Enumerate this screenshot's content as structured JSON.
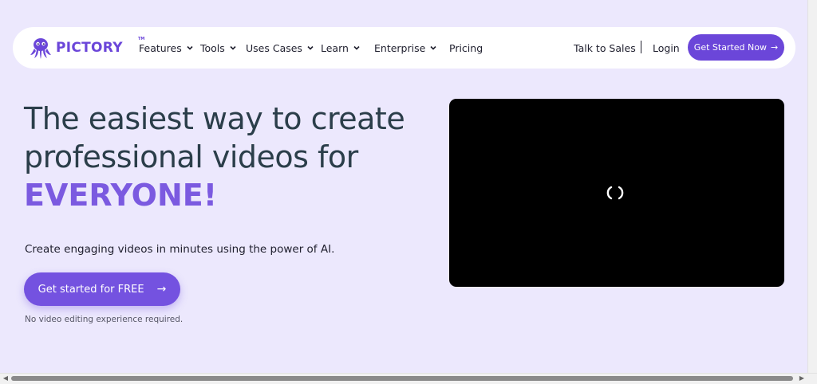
{
  "brand": {
    "name": "PICTORY",
    "tm": "TM",
    "color": "#6b46d9"
  },
  "nav": {
    "items": [
      {
        "label": "Features",
        "has_dropdown": true
      },
      {
        "label": "Tools",
        "has_dropdown": true
      },
      {
        "label": "Uses Cases",
        "has_dropdown": true
      },
      {
        "label": "Learn",
        "has_dropdown": true
      },
      {
        "label": "Enterprise",
        "has_dropdown": true
      },
      {
        "label": "Pricing",
        "has_dropdown": false
      }
    ],
    "talk_to_sales": "Talk to Sales",
    "separator": "|",
    "login": "Login",
    "cta": "Get Started Now",
    "cta_arrow": "→"
  },
  "hero": {
    "title_line1": "The easiest way to create",
    "title_line2": "professional videos for",
    "title_accent": "EVERYONE!",
    "subtitle": "Create engaging videos in minutes using the power of AI.",
    "cta": "Get started for FREE",
    "cta_arrow": "→",
    "note": "No video editing experience required."
  },
  "video": {
    "state": "loading",
    "icon": "loading-spinner-icon"
  },
  "colors": {
    "background": "#ece8fd",
    "accent": "#7452e0",
    "heading": "#2b3e4a"
  }
}
